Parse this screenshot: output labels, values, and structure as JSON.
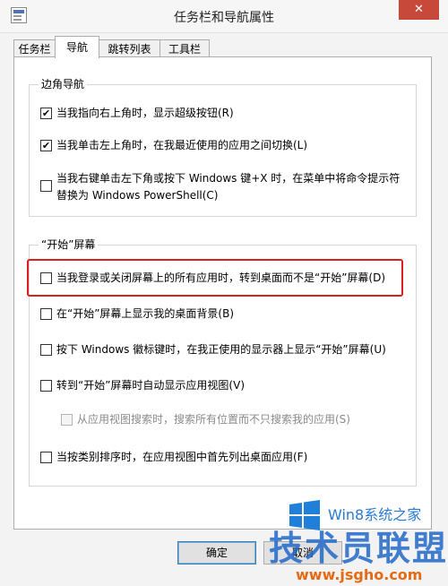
{
  "window": {
    "title": "任务栏和导航属性",
    "close_glyph": "✕"
  },
  "tabs": [
    {
      "label": "任务栏"
    },
    {
      "label": "导航"
    },
    {
      "label": "跳转列表"
    },
    {
      "label": "工具栏"
    }
  ],
  "corner_nav": {
    "heading": "边角导航",
    "options": [
      {
        "label": "当我指向右上角时，显示超级按钮(R)",
        "checked": true
      },
      {
        "label": "当我单击左上角时，在我最近使用的应用之间切换(L)",
        "checked": true
      },
      {
        "label": "当我右键单击左下角或按下 Windows 键+X 时，在菜单中将命令提示符替换为 Windows PowerShell(C)",
        "checked": false
      }
    ]
  },
  "start_screen": {
    "heading": "“开始”屏幕",
    "options": [
      {
        "label": "当我登录或关闭屏幕上的所有应用时，转到桌面而不是“开始”屏幕(D)",
        "checked": false
      },
      {
        "label": "在“开始”屏幕上显示我的桌面背景(B)",
        "checked": false
      },
      {
        "label": "按下 Windows 徽标键时，在我正使用的显示器上显示“开始”屏幕(U)",
        "checked": false
      },
      {
        "label": "转到“开始”屏幕时自动显示应用视图(V)",
        "checked": false
      },
      {
        "label": "从应用视图搜索时，搜索所有位置而不只搜索我的应用(S)",
        "checked": false,
        "disabled": true
      },
      {
        "label": "当按类别排序时，在应用视图中首先列出桌面应用(F)",
        "checked": false
      }
    ]
  },
  "buttons": {
    "ok": "确定",
    "cancel": "取消"
  },
  "watermark": {
    "site": "Win8系统之家",
    "brand": "技术员联盟",
    "url": "www.jsgho.com"
  },
  "colors": {
    "highlight": "#d9201e",
    "close": "#c7493a",
    "brand_blue": "#2169c9"
  }
}
